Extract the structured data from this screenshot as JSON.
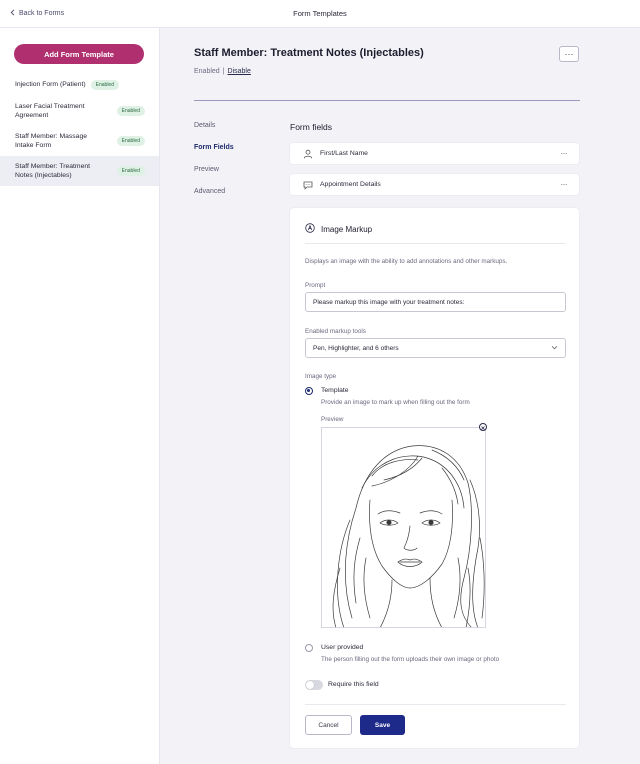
{
  "topbar": {
    "back_label": "Back to Forms",
    "title": "Form Templates"
  },
  "sidebar": {
    "add_button": "Add Form Template",
    "items": [
      {
        "label": "Injection Form (Patient)",
        "badge": "Enabled"
      },
      {
        "label_lines": [
          "Laser Facial Treatment",
          "Agreement"
        ],
        "badge": "Enabled"
      },
      {
        "label_lines": [
          "Staff Member: Massage",
          "Intake Form"
        ],
        "badge": "Enabled"
      },
      {
        "label_lines": [
          "Staff Member: Treatment",
          "Notes (Injectables)"
        ],
        "badge": "Enabled",
        "active": true
      }
    ]
  },
  "header": {
    "title": "Staff Member: Treatment Notes (Injectables)",
    "status": "Enabled",
    "separator": "|",
    "disable_label": "Disable",
    "more_label": "···"
  },
  "nav": {
    "items": [
      "Details",
      "Form Fields",
      "Preview",
      "Advanced"
    ],
    "active": "Form Fields"
  },
  "form_fields": {
    "title": "Form fields",
    "fields": [
      {
        "label": "First/Last Name",
        "icon": "person-icon"
      },
      {
        "label": "Appointment Details",
        "icon": "chat-bubble-icon"
      }
    ],
    "more_label": "···"
  },
  "image_markup": {
    "title": "Image Markup",
    "icon": "markup-pen-icon",
    "description": "Displays an image with the ability to add annotations and other markups.",
    "prompt_label": "Prompt",
    "prompt_value": "Please markup this image with your treatment notes:",
    "tools_label": "Enabled markup tools",
    "tools_value": "Pen, Highlighter, and 6 others",
    "image_type_label": "Image type",
    "option_template_title": "Template",
    "option_template_desc": "Provide an image to mark up when filling out the form",
    "preview_label": "Preview",
    "option_user_title": "User provided",
    "option_user_desc": "The person filling out the form uploads their own image or photo",
    "selected_option": "Template",
    "require_label": "Require this field",
    "require_enabled": false,
    "cancel_label": "Cancel",
    "save_label": "Save"
  },
  "colors": {
    "accent_pink": "#b0306f",
    "primary_navy": "#1e2a8a",
    "badge_bg": "#dff1e5",
    "badge_text": "#2e6b45"
  }
}
